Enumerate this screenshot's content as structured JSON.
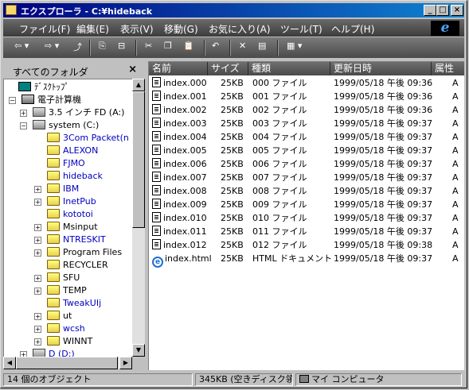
{
  "window": {
    "title": "エクスプローラ - C:¥hideback"
  },
  "title_buttons": {
    "minimize": "_",
    "maximize": "□",
    "close": "×"
  },
  "menu": {
    "items": [
      {
        "label": "ファイル(F)"
      },
      {
        "label": "編集(E)"
      },
      {
        "label": "表示(V)"
      },
      {
        "label": "移動(G)"
      },
      {
        "label": "お気に入り(A)"
      },
      {
        "label": "ツール(T)"
      },
      {
        "label": "ヘルプ(H)"
      }
    ],
    "logo": "e"
  },
  "toolbar": {
    "back_glyph": "⇦ ▾",
    "forward_glyph": "⇨ ▾",
    "up_glyph": "⤴",
    "map_glyph": "⎘",
    "disconnect_glyph": "⊟",
    "cut_glyph": "✂",
    "copy_glyph": "❐",
    "paste_glyph": "📋",
    "undo_glyph": "↶",
    "delete_glyph": "✕",
    "properties_glyph": "▤",
    "views_glyph": "▦ ▾"
  },
  "folder_pane": {
    "title": "すべてのフォルダ",
    "close": "×",
    "tree": [
      {
        "label": "ﾃﾞｽｸﾄｯﾌﾟ",
        "icon": "desk",
        "indent": 0,
        "expander": "",
        "blue": false
      },
      {
        "label": "電子計算機",
        "icon": "pc",
        "indent": 1,
        "expander": "−",
        "blue": false
      },
      {
        "label": "3.5 インチ FD (A:)",
        "icon": "drive",
        "indent": 2,
        "expander": "+",
        "blue": false
      },
      {
        "label": "system (C:)",
        "icon": "drive",
        "indent": 2,
        "expander": "−",
        "blue": false
      },
      {
        "label": "3Com Packet(n",
        "icon": "folder",
        "indent": 3,
        "expander": "",
        "blue": true
      },
      {
        "label": "ALEXON",
        "icon": "folder",
        "indent": 3,
        "expander": "",
        "blue": true
      },
      {
        "label": "FJMO",
        "icon": "folder",
        "indent": 3,
        "expander": "",
        "blue": true
      },
      {
        "label": "hideback",
        "icon": "folder",
        "indent": 3,
        "expander": "",
        "blue": true
      },
      {
        "label": "IBM",
        "icon": "folder",
        "indent": 3,
        "expander": "+",
        "blue": true
      },
      {
        "label": "InetPub",
        "icon": "folder",
        "indent": 3,
        "expander": "+",
        "blue": true
      },
      {
        "label": "kototoi",
        "icon": "folder",
        "indent": 3,
        "expander": "",
        "blue": true
      },
      {
        "label": "Msinput",
        "icon": "folder",
        "indent": 3,
        "expander": "+",
        "blue": false
      },
      {
        "label": "NTRESKIT",
        "icon": "folder",
        "indent": 3,
        "expander": "+",
        "blue": true
      },
      {
        "label": "Program Files",
        "icon": "folder",
        "indent": 3,
        "expander": "+",
        "blue": false
      },
      {
        "label": "RECYCLER",
        "icon": "folder",
        "indent": 3,
        "expander": "",
        "blue": false
      },
      {
        "label": "SFU",
        "icon": "folder",
        "indent": 3,
        "expander": "+",
        "blue": false
      },
      {
        "label": "TEMP",
        "icon": "folder",
        "indent": 3,
        "expander": "+",
        "blue": false
      },
      {
        "label": "TweakUIj",
        "icon": "folder",
        "indent": 3,
        "expander": "",
        "blue": true
      },
      {
        "label": "ut",
        "icon": "folder",
        "indent": 3,
        "expander": "+",
        "blue": false
      },
      {
        "label": "wcsh",
        "icon": "folder",
        "indent": 3,
        "expander": "+",
        "blue": true
      },
      {
        "label": "WINNT",
        "icon": "folder",
        "indent": 3,
        "expander": "+",
        "blue": false
      },
      {
        "label": "D (D:)",
        "icon": "drive",
        "indent": 2,
        "expander": "+",
        "blue": true
      }
    ]
  },
  "file_list": {
    "columns": [
      {
        "label": "名前"
      },
      {
        "label": "サイズ"
      },
      {
        "label": "種類"
      },
      {
        "label": "更新日時"
      },
      {
        "label": "属性"
      }
    ],
    "rows": [
      {
        "name": "index.000",
        "size": "25KB",
        "type": "000 ファイル",
        "modified": "1999/05/18 午後 09:36",
        "attr": "A",
        "icon": "doc"
      },
      {
        "name": "index.001",
        "size": "25KB",
        "type": "001 ファイル",
        "modified": "1999/05/18 午後 09:36",
        "attr": "A",
        "icon": "doc"
      },
      {
        "name": "index.002",
        "size": "25KB",
        "type": "002 ファイル",
        "modified": "1999/05/18 午後 09:36",
        "attr": "A",
        "icon": "doc"
      },
      {
        "name": "index.003",
        "size": "25KB",
        "type": "003 ファイル",
        "modified": "1999/05/18 午後 09:37",
        "attr": "A",
        "icon": "doc"
      },
      {
        "name": "index.004",
        "size": "25KB",
        "type": "004 ファイル",
        "modified": "1999/05/18 午後 09:37",
        "attr": "A",
        "icon": "doc"
      },
      {
        "name": "index.005",
        "size": "25KB",
        "type": "005 ファイル",
        "modified": "1999/05/18 午後 09:37",
        "attr": "A",
        "icon": "doc"
      },
      {
        "name": "index.006",
        "size": "25KB",
        "type": "006 ファイル",
        "modified": "1999/05/18 午後 09:37",
        "attr": "A",
        "icon": "doc"
      },
      {
        "name": "index.007",
        "size": "25KB",
        "type": "007 ファイル",
        "modified": "1999/05/18 午後 09:37",
        "attr": "A",
        "icon": "doc"
      },
      {
        "name": "index.008",
        "size": "25KB",
        "type": "008 ファイル",
        "modified": "1999/05/18 午後 09:37",
        "attr": "A",
        "icon": "doc"
      },
      {
        "name": "index.009",
        "size": "25KB",
        "type": "009 ファイル",
        "modified": "1999/05/18 午後 09:37",
        "attr": "A",
        "icon": "doc"
      },
      {
        "name": "index.010",
        "size": "25KB",
        "type": "010 ファイル",
        "modified": "1999/05/18 午後 09:37",
        "attr": "A",
        "icon": "doc"
      },
      {
        "name": "index.011",
        "size": "25KB",
        "type": "011 ファイル",
        "modified": "1999/05/18 午後 09:37",
        "attr": "A",
        "icon": "doc"
      },
      {
        "name": "index.012",
        "size": "25KB",
        "type": "012 ファイル",
        "modified": "1999/05/18 午後 09:38",
        "attr": "A",
        "icon": "doc"
      },
      {
        "name": "index.html",
        "size": "25KB",
        "type": "HTML ドキュメント",
        "modified": "1999/05/18 午後 09:37",
        "attr": "A",
        "icon": "ie"
      }
    ]
  },
  "status": {
    "objects": "14 個のオブジェクト",
    "size": "345KB (空きディスク領",
    "location": "マイ コンピュータ"
  }
}
